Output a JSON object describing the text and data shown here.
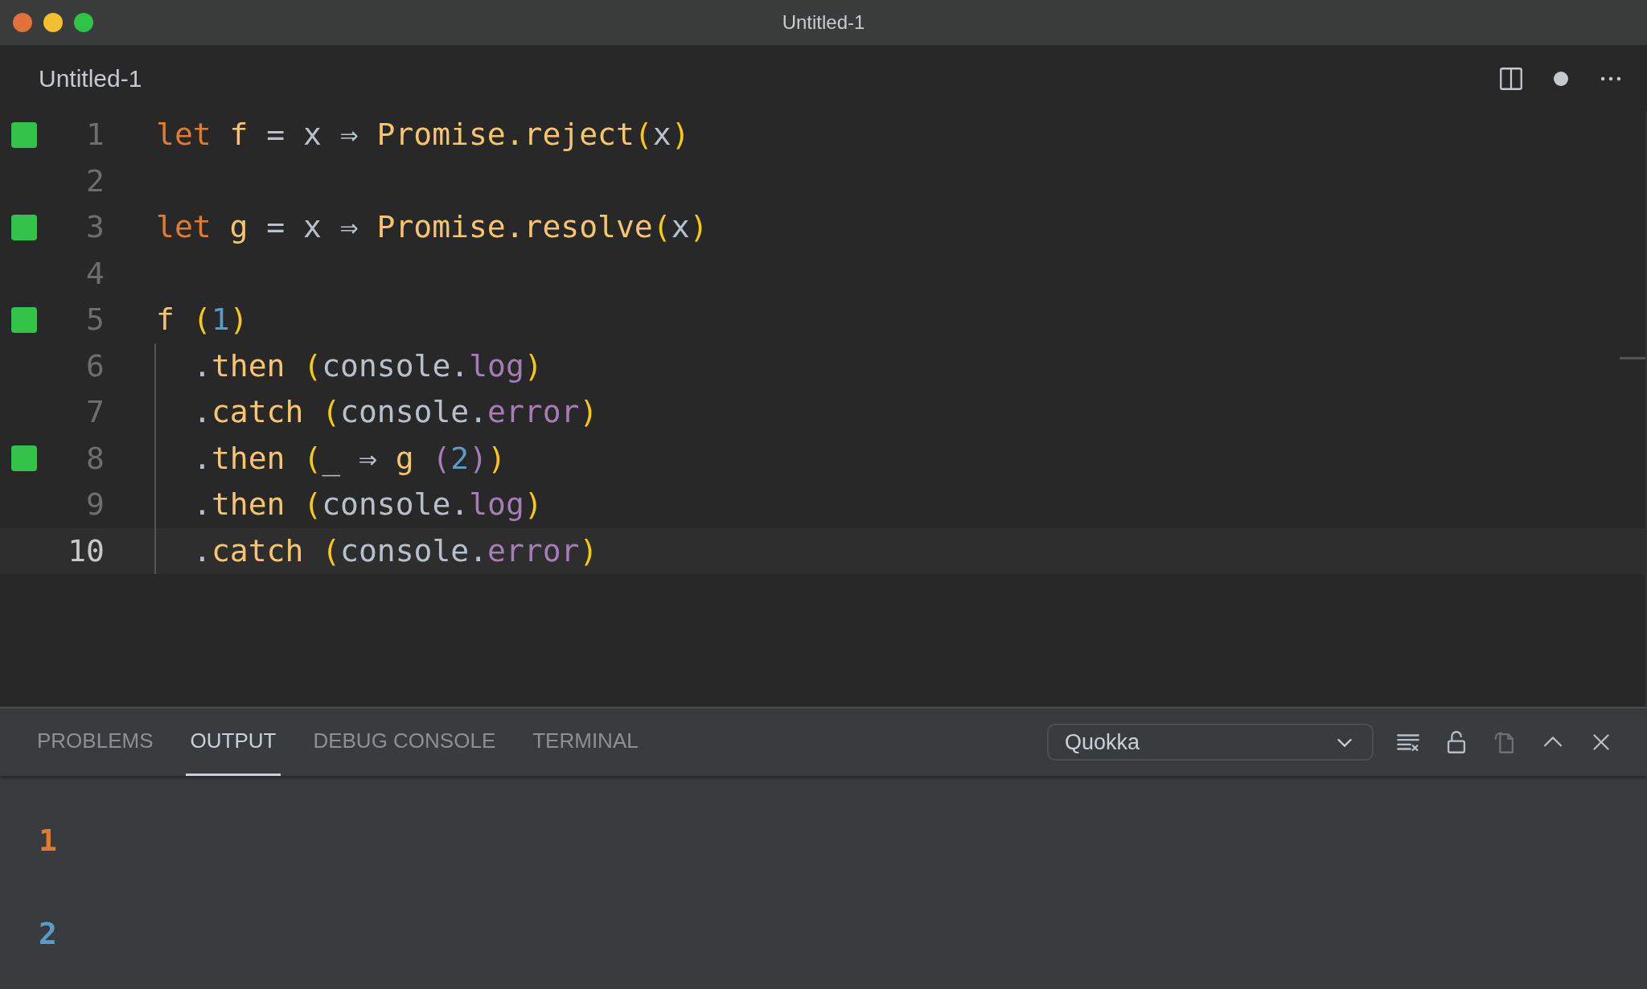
{
  "window": {
    "title": "Untitled-1"
  },
  "editor_tab": {
    "title": "Untitled-1",
    "dirty": true
  },
  "code_lines": [
    {
      "number": "1",
      "covered": true,
      "current": false,
      "indented": false,
      "tokens": [
        {
          "kind": "keyword",
          "text": "let"
        },
        {
          "kind": "func",
          "text": " f"
        },
        {
          "kind": "plain",
          "text": " = x ⇒ "
        },
        {
          "kind": "func",
          "text": "Promise.reject"
        },
        {
          "kind": "paren",
          "text": "("
        },
        {
          "kind": "plain",
          "text": "x"
        },
        {
          "kind": "paren",
          "text": ")"
        }
      ]
    },
    {
      "number": "2",
      "covered": false,
      "current": false,
      "indented": false
    },
    {
      "number": "3",
      "covered": true,
      "current": false,
      "indented": false,
      "tokens": [
        {
          "kind": "keyword",
          "text": "let"
        },
        {
          "kind": "func",
          "text": " g"
        },
        {
          "kind": "plain",
          "text": " = x ⇒ "
        },
        {
          "kind": "func",
          "text": "Promise.resolve"
        },
        {
          "kind": "paren",
          "text": "("
        },
        {
          "kind": "plain",
          "text": "x"
        },
        {
          "kind": "paren",
          "text": ")"
        }
      ]
    },
    {
      "number": "4",
      "covered": false,
      "current": false,
      "indented": false
    },
    {
      "number": "5",
      "covered": true,
      "current": false,
      "indented": false,
      "tokens": [
        {
          "kind": "func",
          "text": "f"
        },
        {
          "kind": "paren",
          "text": " ("
        },
        {
          "kind": "number",
          "text": "1"
        },
        {
          "kind": "paren",
          "text": ")"
        }
      ]
    },
    {
      "number": "6",
      "covered": false,
      "current": false,
      "indented": true,
      "tokens": [
        {
          "kind": "plain",
          "text": "."
        },
        {
          "kind": "func",
          "text": "then"
        },
        {
          "kind": "paren",
          "text": " ("
        },
        {
          "kind": "plain",
          "text": "console."
        },
        {
          "kind": "prop",
          "text": "log"
        },
        {
          "kind": "paren",
          "text": ")"
        }
      ]
    },
    {
      "number": "7",
      "covered": false,
      "current": false,
      "indented": true,
      "tokens": [
        {
          "kind": "plain",
          "text": "."
        },
        {
          "kind": "func",
          "text": "catch"
        },
        {
          "kind": "paren",
          "text": " ("
        },
        {
          "kind": "plain",
          "text": "console."
        },
        {
          "kind": "prop",
          "text": "error"
        },
        {
          "kind": "paren",
          "text": ")"
        }
      ]
    },
    {
      "number": "8",
      "covered": true,
      "current": false,
      "indented": true,
      "tokens": [
        {
          "kind": "plain",
          "text": "."
        },
        {
          "kind": "func",
          "text": "then"
        },
        {
          "kind": "paren",
          "text": " ("
        },
        {
          "kind": "plain",
          "text": "_ ⇒ "
        },
        {
          "kind": "func",
          "text": "g"
        },
        {
          "kind": "prop",
          "text": " ("
        },
        {
          "kind": "number",
          "text": "2"
        },
        {
          "kind": "prop",
          "text": ")"
        },
        {
          "kind": "paren",
          "text": ")"
        }
      ]
    },
    {
      "number": "9",
      "covered": false,
      "current": false,
      "indented": true,
      "tokens": [
        {
          "kind": "plain",
          "text": "."
        },
        {
          "kind": "func",
          "text": "then"
        },
        {
          "kind": "paren",
          "text": " ("
        },
        {
          "kind": "plain",
          "text": "console."
        },
        {
          "kind": "prop",
          "text": "log"
        },
        {
          "kind": "paren",
          "text": ")"
        }
      ]
    },
    {
      "number": "10",
      "covered": false,
      "current": true,
      "indented": true,
      "tokens": [
        {
          "kind": "plain",
          "text": "."
        },
        {
          "kind": "func",
          "text": "catch"
        },
        {
          "kind": "paren",
          "text": " ("
        },
        {
          "kind": "plain",
          "text": "console."
        },
        {
          "kind": "prop",
          "text": "error"
        },
        {
          "kind": "paren",
          "text": ")"
        }
      ]
    }
  ],
  "panel_tabs": [
    {
      "label": "PROBLEMS",
      "selected": false
    },
    {
      "label": "OUTPUT",
      "selected": true
    },
    {
      "label": "DEBUG CONSOLE",
      "selected": false
    },
    {
      "label": "TERMINAL",
      "selected": false
    }
  ],
  "output_channel": {
    "value": "Quokka"
  },
  "output_lines": [
    {
      "text": "1",
      "color": "#e07b2f"
    },
    {
      "text": "2",
      "color": "#5b9bc8"
    }
  ]
}
